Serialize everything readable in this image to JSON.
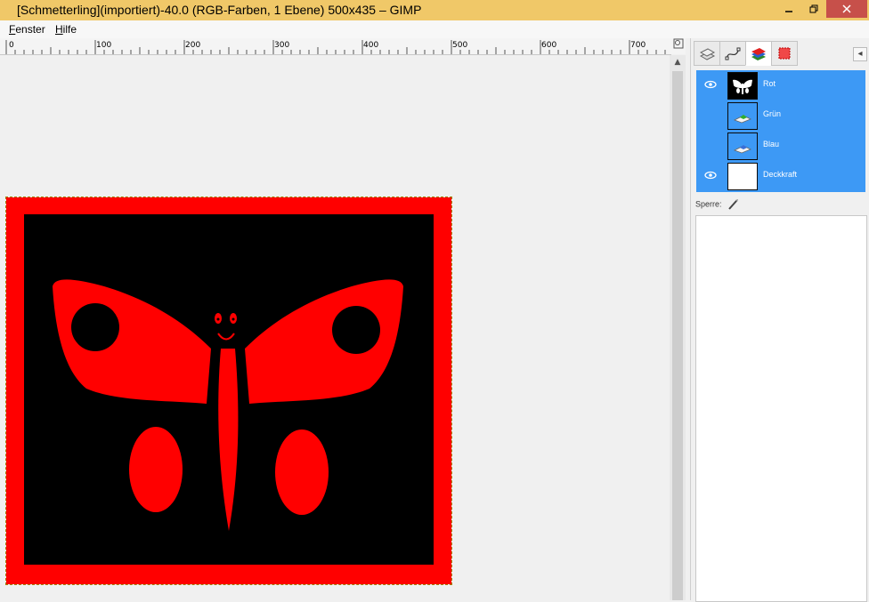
{
  "window": {
    "title": "[Schmetterling](importiert)-40.0 (RGB-Farben, 1 Ebene) 500x435 – GIMP",
    "minimize_icon": "minimize-icon",
    "maximize_icon": "restore-icon",
    "close_icon": "close-icon"
  },
  "menu": {
    "items": [
      "Fenster",
      "Hilfe"
    ]
  },
  "ruler": {
    "labels": [
      "0",
      "100",
      "200",
      "300",
      "400",
      "500",
      "600",
      "700"
    ]
  },
  "dock": {
    "tabs": [
      "layers-icon",
      "paths-icon",
      "channels-icon",
      "color-icon"
    ],
    "active_tab": 2,
    "channels": [
      {
        "name": "Rot",
        "visible": true
      },
      {
        "name": "Grün",
        "visible": false
      },
      {
        "name": "Blau",
        "visible": false
      },
      {
        "name": "Deckkraft",
        "visible": true
      }
    ],
    "lock_label": "Sperre:"
  },
  "colors": {
    "red": "#ff0000",
    "black": "#000000",
    "selection_blue": "#3d99f5",
    "titlebar": "#f0c868"
  }
}
